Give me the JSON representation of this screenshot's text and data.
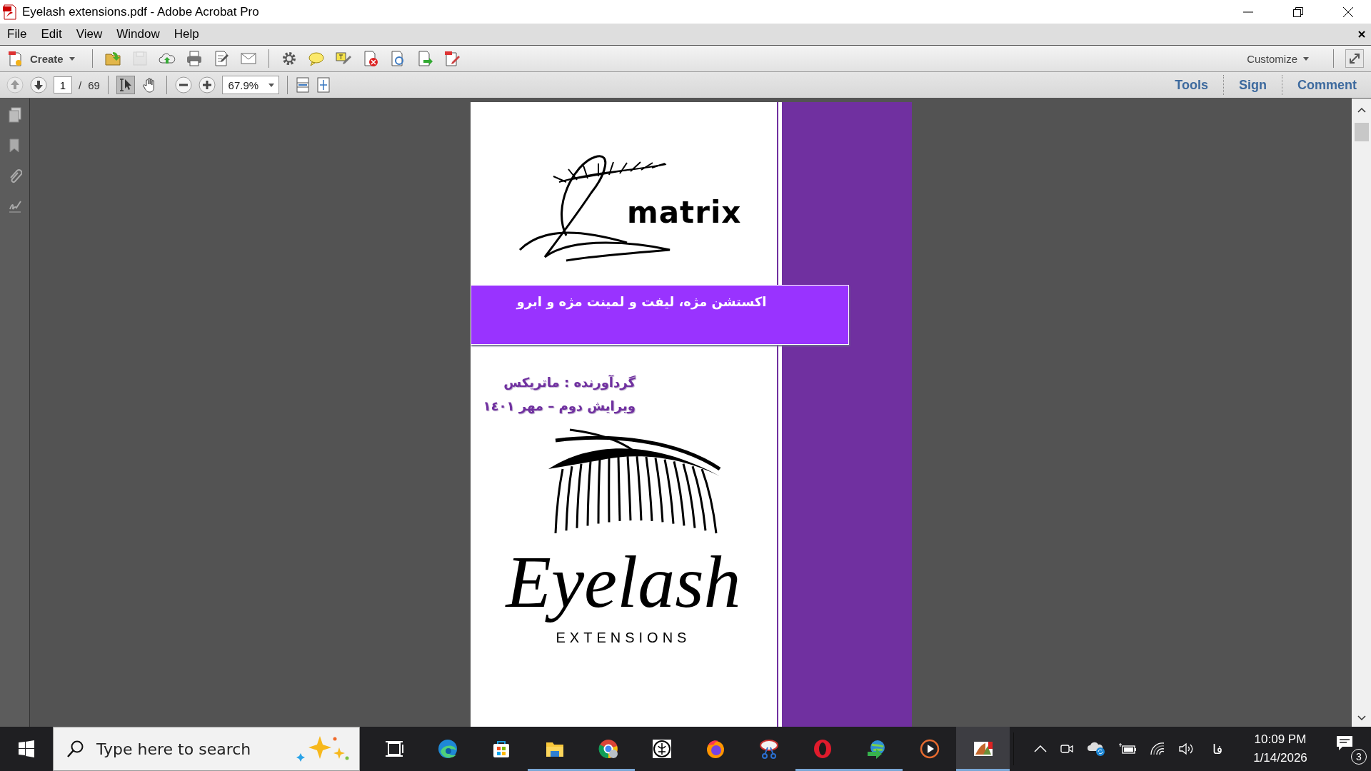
{
  "window": {
    "title": "Eyelash extensions.pdf - Adobe Acrobat Pro"
  },
  "menu": [
    {
      "label": "File"
    },
    {
      "label": "Edit"
    },
    {
      "label": "View"
    },
    {
      "label": "Window"
    },
    {
      "label": "Help"
    }
  ],
  "toolbar": {
    "create": "Create",
    "customize": "Customize",
    "buttons": [
      {
        "kind": "open",
        "disabled": false
      },
      {
        "kind": "save",
        "disabled": true
      },
      {
        "kind": "upload",
        "disabled": false
      },
      {
        "kind": "print",
        "disabled": false
      },
      {
        "kind": "edit",
        "disabled": false
      },
      {
        "kind": "email",
        "disabled": false
      },
      {
        "kind": "separator"
      },
      {
        "kind": "gear",
        "disabled": false
      },
      {
        "kind": "comment",
        "disabled": false
      },
      {
        "kind": "highlight",
        "disabled": false
      },
      {
        "kind": "doc-delete",
        "disabled": false
      },
      {
        "kind": "doc-rotate",
        "disabled": false
      },
      {
        "kind": "doc-export",
        "disabled": false
      },
      {
        "kind": "doc-edit",
        "disabled": false
      }
    ]
  },
  "navigation": {
    "previous_disabled": true,
    "next_disabled": false,
    "page": "1",
    "separator": "/",
    "total": "69",
    "zoom": "67.9%"
  },
  "panes": [
    {
      "label": "Tools"
    },
    {
      "label": "Sign"
    },
    {
      "label": "Comment"
    }
  ],
  "document": {
    "logo_text": "matrix",
    "banner": "اکستشن مژه، لیفت و لمینت مژه و ابرو",
    "credits": [
      "گردآورنده : ماتریکس",
      "ویرایش دوم – مهر ١٤٠١"
    ],
    "title": "Eyelash",
    "subtitle": "EXTENSIONS"
  },
  "taskbar": {
    "search_placeholder": "Type here to search",
    "apps": [
      {
        "kind": "task-view",
        "running": false,
        "selected": false
      },
      {
        "kind": "edge",
        "running": false,
        "selected": false
      },
      {
        "kind": "store",
        "running": false,
        "selected": false
      },
      {
        "kind": "folder",
        "running": true,
        "selected": false
      },
      {
        "kind": "chrome",
        "running": true,
        "selected": false
      },
      {
        "kind": "emblem",
        "running": false,
        "selected": false
      },
      {
        "kind": "firefox",
        "running": false,
        "selected": false
      },
      {
        "kind": "scissors",
        "running": false,
        "selected": false
      },
      {
        "kind": "opera",
        "running": true,
        "selected": false
      },
      {
        "kind": "downloader",
        "running": true,
        "selected": false
      },
      {
        "kind": "player",
        "running": false,
        "selected": false
      },
      {
        "kind": "pdf",
        "running": true,
        "selected": true
      }
    ],
    "language": "فا",
    "time": "10:09 PM",
    "date": "1/14/2026",
    "notifications": "3"
  }
}
